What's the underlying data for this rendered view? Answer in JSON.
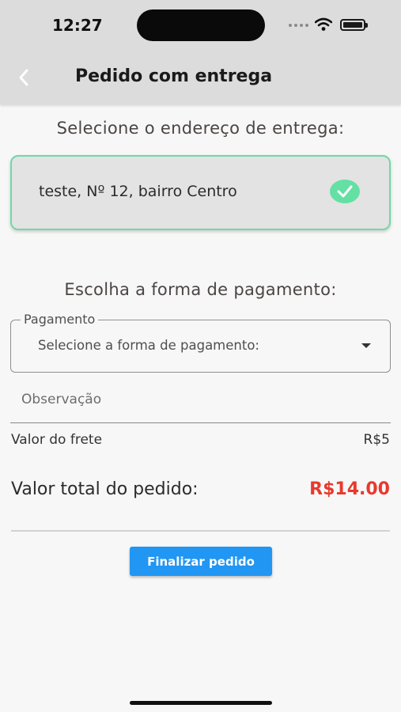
{
  "status_bar": {
    "time": "12:27",
    "icons": [
      "signal-dots-icon",
      "wifi-icon",
      "battery-icon"
    ]
  },
  "header": {
    "back_icon": "chevron-left-icon",
    "title": "Pedido com entrega"
  },
  "address": {
    "section_title": "Selecione o endereço de entrega:",
    "selected_address": "teste, Nº 12, bairro Centro",
    "selected": true,
    "check_icon": "check-circle-icon"
  },
  "payment": {
    "section_title": "Escolha a forma de pagamento:",
    "field_label": "Pagamento",
    "placeholder": "Selecione a forma de pagamento:",
    "dropdown_icon": "caret-down-icon"
  },
  "observation": {
    "placeholder": "Observação"
  },
  "summary": {
    "freight_label": "Valor do frete",
    "freight_value": "R$5",
    "total_label": "Valor total do pedido:",
    "total_value": "R$14.00"
  },
  "actions": {
    "finish_label": "Finalizar pedido"
  },
  "colors": {
    "accent_button": "#2196f3",
    "selected_border": "#6fd9a8",
    "total_value": "#e8392e"
  }
}
